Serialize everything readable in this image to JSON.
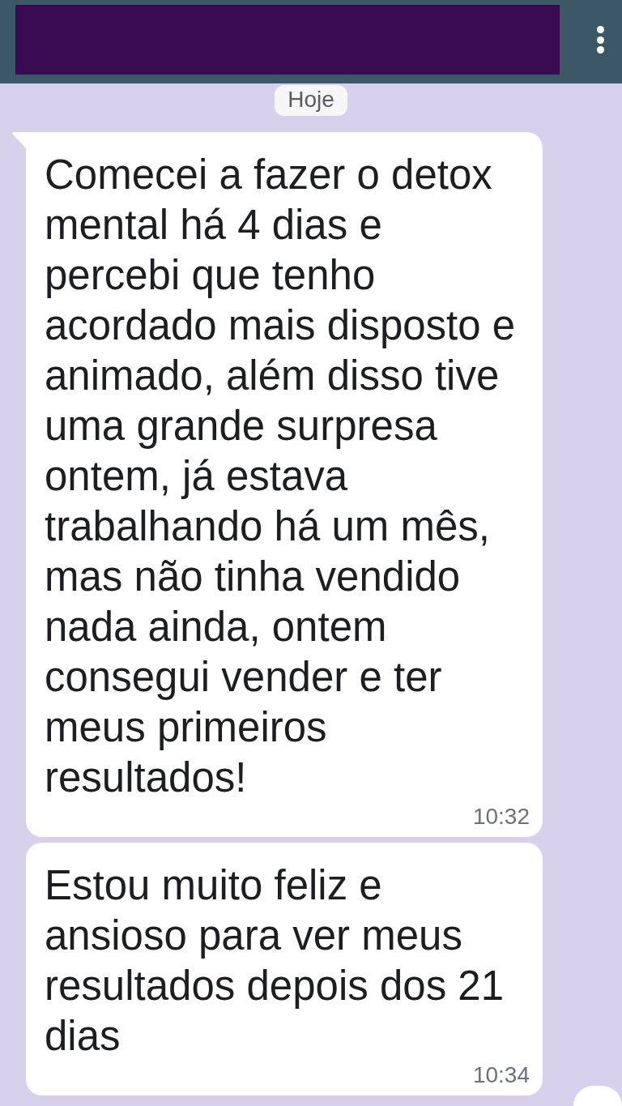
{
  "header": {
    "date_chip": "Hoje"
  },
  "messages": [
    {
      "text": "Comecei a fazer o detox mental há 4 dias e percebi que tenho acordado mais disposto e animado, além disso tive uma grande surpresa ontem, já estava trabalhando há um mês, mas não tinha vendido nada ainda, ontem consegui vender e ter meus primeiros resultados!",
      "time": "10:32",
      "tail": true
    },
    {
      "text": "Estou muito feliz e ansioso para ver meus resultados depois dos 21 dias",
      "time": "10:34",
      "tail": false
    }
  ]
}
